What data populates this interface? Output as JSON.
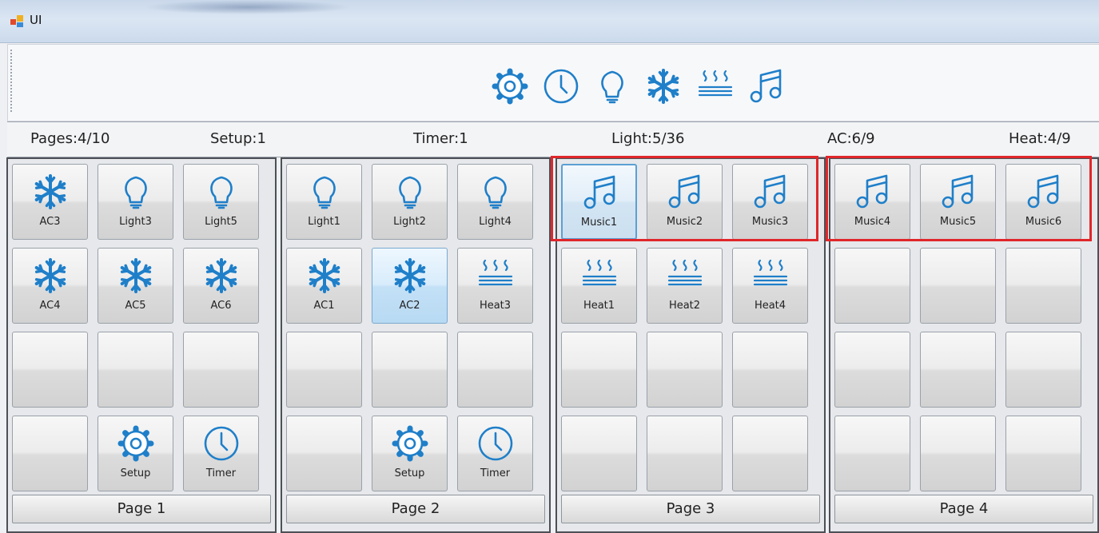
{
  "window": {
    "title": "UI"
  },
  "toolbar": {
    "icons": [
      "gear-icon",
      "clock-icon",
      "lightbulb-icon",
      "snowflake-icon",
      "heat-icon",
      "music-icon"
    ]
  },
  "status": {
    "pages": "Pages:4/10",
    "setup": "Setup:1",
    "timer": "Timer:1",
    "light": "Light:5/36",
    "ac": "AC:6/9",
    "heat": "Heat:4/9"
  },
  "accent_color": "#1f7fc9",
  "highlight_color": "#e0262a",
  "pages": [
    {
      "label": "Page 1",
      "cells": [
        {
          "icon": "snowflake",
          "label": "AC3"
        },
        {
          "icon": "bulb",
          "label": "Light3"
        },
        {
          "icon": "bulb",
          "label": "Light5"
        },
        {
          "icon": "snowflake",
          "label": "AC4"
        },
        {
          "icon": "snowflake",
          "label": "AC5"
        },
        {
          "icon": "snowflake",
          "label": "AC6"
        },
        {
          "icon": "",
          "label": ""
        },
        {
          "icon": "",
          "label": ""
        },
        {
          "icon": "",
          "label": ""
        },
        {
          "icon": "",
          "label": ""
        },
        {
          "icon": "gear",
          "label": "Setup"
        },
        {
          "icon": "clock",
          "label": "Timer"
        }
      ]
    },
    {
      "label": "Page 2",
      "cells": [
        {
          "icon": "bulb",
          "label": "Light1"
        },
        {
          "icon": "bulb",
          "label": "Light2"
        },
        {
          "icon": "bulb",
          "label": "Light4"
        },
        {
          "icon": "snowflake",
          "label": "AC1"
        },
        {
          "icon": "snowflake",
          "label": "AC2",
          "state": "selected"
        },
        {
          "icon": "heat",
          "label": "Heat3"
        },
        {
          "icon": "",
          "label": ""
        },
        {
          "icon": "",
          "label": ""
        },
        {
          "icon": "",
          "label": ""
        },
        {
          "icon": "",
          "label": ""
        },
        {
          "icon": "gear",
          "label": "Setup"
        },
        {
          "icon": "clock",
          "label": "Timer"
        }
      ]
    },
    {
      "label": "Page 3",
      "cells": [
        {
          "icon": "music",
          "label": "Music1",
          "state": "focused"
        },
        {
          "icon": "music",
          "label": "Music2"
        },
        {
          "icon": "music",
          "label": "Music3"
        },
        {
          "icon": "heat",
          "label": "Heat1"
        },
        {
          "icon": "heat",
          "label": "Heat2"
        },
        {
          "icon": "heat",
          "label": "Heat4"
        },
        {
          "icon": "",
          "label": ""
        },
        {
          "icon": "",
          "label": ""
        },
        {
          "icon": "",
          "label": ""
        },
        {
          "icon": "",
          "label": ""
        },
        {
          "icon": "",
          "label": ""
        },
        {
          "icon": "",
          "label": ""
        }
      ]
    },
    {
      "label": "Page 4",
      "cells": [
        {
          "icon": "music",
          "label": "Music4"
        },
        {
          "icon": "music",
          "label": "Music5"
        },
        {
          "icon": "music",
          "label": "Music6"
        },
        {
          "icon": "",
          "label": ""
        },
        {
          "icon": "",
          "label": ""
        },
        {
          "icon": "",
          "label": ""
        },
        {
          "icon": "",
          "label": ""
        },
        {
          "icon": "",
          "label": ""
        },
        {
          "icon": "",
          "label": ""
        },
        {
          "icon": "",
          "label": ""
        },
        {
          "icon": "",
          "label": ""
        },
        {
          "icon": "",
          "label": ""
        }
      ]
    }
  ]
}
